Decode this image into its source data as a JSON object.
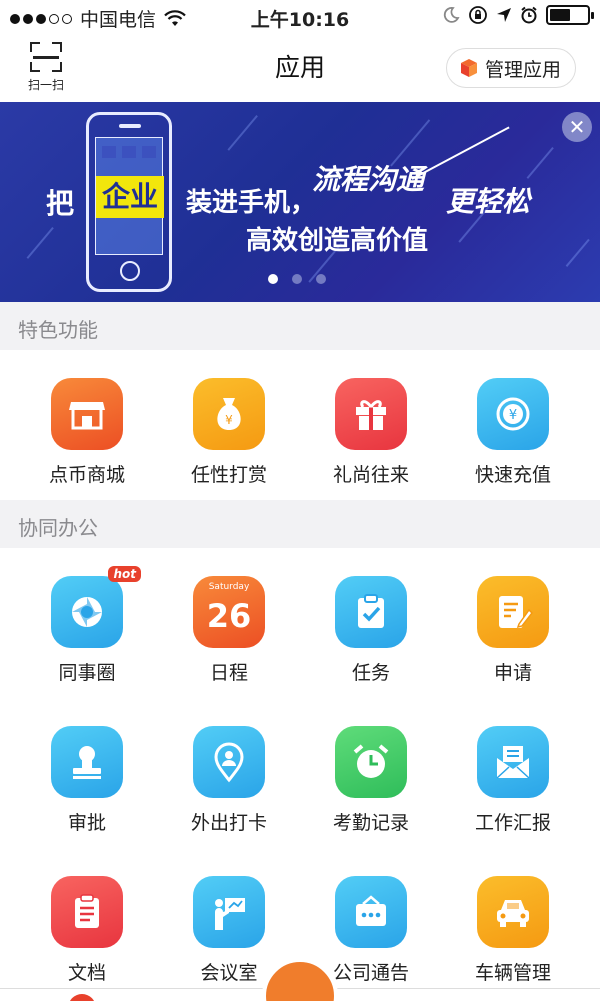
{
  "status_bar": {
    "carrier": "中国电信",
    "time": "上午10:16"
  },
  "nav": {
    "scan_label": "扫一扫",
    "title": "应用",
    "manage_label": "管理应用"
  },
  "banner": {
    "text_ba": "把",
    "text_qiye": "企业",
    "text_zhuang": "装进手机，",
    "text_liucheng": "流程沟通",
    "text_geng": "更轻松",
    "text_gaoxiao": "高效创造高价值",
    "close_icon": "close-icon",
    "page_indicator": {
      "count": 3,
      "active": 1
    }
  },
  "sections": {
    "featured": {
      "title": "特色功能",
      "items": [
        {
          "label": "点币商城",
          "icon": "store-icon",
          "color": "#f26a2e"
        },
        {
          "label": "任性打赏",
          "icon": "money-bag-icon",
          "color": "#f8a31b"
        },
        {
          "label": "礼尚往来",
          "icon": "gift-icon",
          "color": "#f0444b"
        },
        {
          "label": "快速充值",
          "icon": "coin-icon",
          "color": "#34b5ef"
        }
      ]
    },
    "office": {
      "title": "协同办公",
      "items": [
        {
          "label": "同事圈",
          "icon": "camera-shutter-icon",
          "color": "#33b6ee",
          "badge": "hot"
        },
        {
          "label": "日程",
          "icon": "calendar-icon",
          "color": "#f26a2e",
          "cal_day": "Saturday",
          "cal_num": "26"
        },
        {
          "label": "任务",
          "icon": "clipboard-check-icon",
          "color": "#33b6ee"
        },
        {
          "label": "申请",
          "icon": "edit-document-icon",
          "color": "#f8a31b"
        },
        {
          "label": "审批",
          "icon": "stamp-icon",
          "color": "#33b6ee"
        },
        {
          "label": "外出打卡",
          "icon": "location-pin-icon",
          "color": "#33b6ee"
        },
        {
          "label": "考勤记录",
          "icon": "alarm-clock-icon",
          "color": "#38c866"
        },
        {
          "label": "工作汇报",
          "icon": "mail-icon",
          "color": "#33b6ee"
        },
        {
          "label": "文档",
          "icon": "document-icon",
          "color": "#f0444b"
        },
        {
          "label": "会议室",
          "icon": "presenter-icon",
          "color": "#33b6ee"
        },
        {
          "label": "公司通告",
          "icon": "notice-icon",
          "color": "#33b6ee"
        },
        {
          "label": "车辆管理",
          "icon": "car-icon",
          "color": "#f8a31b"
        }
      ]
    }
  }
}
